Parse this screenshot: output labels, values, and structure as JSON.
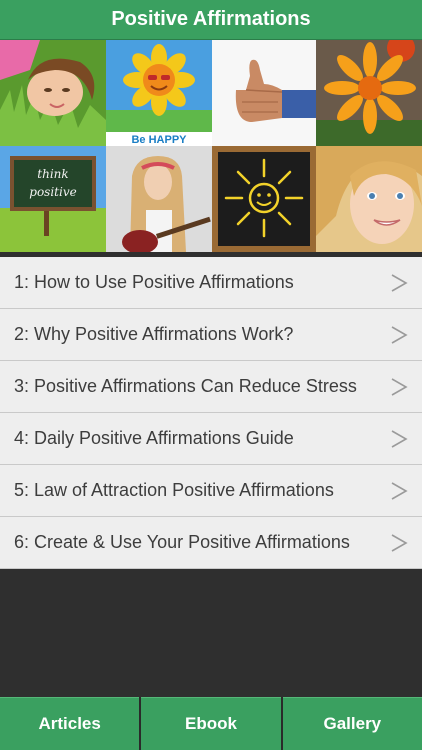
{
  "header": {
    "title": "Positive Affirmations"
  },
  "gallery": {
    "tiles": [
      {
        "icon": "woman-in-grass-photo"
      },
      {
        "icon": "smiling-sunflower-photo",
        "caption": "Be HAPPY"
      },
      {
        "icon": "thumbs-up-photo"
      },
      {
        "icon": "orange-flower-photo"
      },
      {
        "icon": "think-positive-chalkboard-photo",
        "caption": "think positive"
      },
      {
        "icon": "girl-with-guitar-photo"
      },
      {
        "icon": "chalk-sun-photo"
      },
      {
        "icon": "smiling-child-photo"
      }
    ]
  },
  "articles": [
    {
      "label": "1: How to Use Positive Affirmations",
      "chevron": ">"
    },
    {
      "label": "2: Why Positive Affirmations Work?",
      "chevron": ">"
    },
    {
      "label": "3: Positive Affirmations Can Reduce Stress",
      "chevron": ">"
    },
    {
      "label": "4: Daily Positive Affirmations Guide",
      "chevron": ">"
    },
    {
      "label": "5: Law of Attraction Positive Affirmations",
      "chevron": ">"
    },
    {
      "label": "6: Create & Use Your Positive Affirmations",
      "chevron": ">"
    }
  ],
  "tabbar": {
    "tabs": [
      {
        "label": "Articles"
      },
      {
        "label": "Ebook"
      },
      {
        "label": "Gallery"
      }
    ]
  },
  "colors": {
    "brand_green": "#3aa060",
    "row_bg": "#eeeeee",
    "background": "#2f2f2f"
  }
}
